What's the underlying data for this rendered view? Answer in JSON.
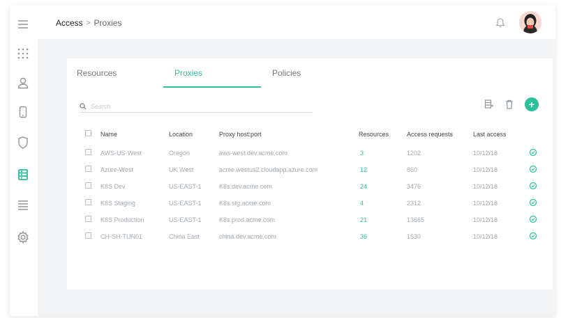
{
  "breadcrumb": {
    "root": "Access",
    "separator": ">",
    "current": "Proxies"
  },
  "header": {
    "bell_icon": "bell-icon",
    "avatar": "user-avatar"
  },
  "sidebar": {
    "items": [
      {
        "icon": "menu-icon",
        "active": false
      },
      {
        "icon": "apps-grid-icon",
        "active": false
      },
      {
        "icon": "user-icon",
        "active": false
      },
      {
        "icon": "mobile-device-icon",
        "active": false
      },
      {
        "icon": "shield-icon",
        "active": false
      },
      {
        "icon": "proxy-server-icon",
        "active": true
      },
      {
        "icon": "list-icon",
        "active": false
      },
      {
        "icon": "settings-icon",
        "active": false
      }
    ]
  },
  "tabs": [
    {
      "label": "Resources",
      "active": false
    },
    {
      "label": "Proxies",
      "active": true
    },
    {
      "label": "Policies",
      "active": false
    }
  ],
  "search": {
    "placeholder": "Search",
    "value": ""
  },
  "toolbar": {
    "export_icon": "export-icon",
    "delete_icon": "trash-icon",
    "add_label": "+"
  },
  "table": {
    "columns": [
      "Name",
      "Location",
      "Proxy host:port",
      "Resources",
      "Access requests",
      "Last access"
    ],
    "rows": [
      {
        "name": "AWS-US-West",
        "location": "Oregon",
        "host": "aws-west.dev.acme.com",
        "resources": "3",
        "requests": "1202",
        "last": "10/12/18"
      },
      {
        "name": "Azure-West",
        "location": "UK West",
        "host": "acme.westus2.cloudapp.azure.com",
        "resources": "12",
        "requests": "860",
        "last": "10/12/18"
      },
      {
        "name": "K8S Dev",
        "location": "US-EAST-1",
        "host": "K8s.dev.acme.com",
        "resources": "24",
        "requests": "3476",
        "last": "10/12/18"
      },
      {
        "name": "K8S Staging",
        "location": "US-EAST-1",
        "host": "K8s.stg.acme.com",
        "resources": "4",
        "requests": "2312",
        "last": "10/12/18"
      },
      {
        "name": "K8S Production",
        "location": "US-EAST-1",
        "host": "K8s.prod.acme.com",
        "resources": "21",
        "requests": "13665",
        "last": "10/12/18"
      },
      {
        "name": "CH-SH-TUN01",
        "location": "China East",
        "host": "china.dev.acme.com",
        "resources": "36",
        "requests": "1530",
        "last": "10/12/18"
      }
    ]
  },
  "colors": {
    "accent": "#2bbf9a",
    "background": "#f2f4f6",
    "card": "#ffffff",
    "muted_text": "#a2a8ad"
  }
}
